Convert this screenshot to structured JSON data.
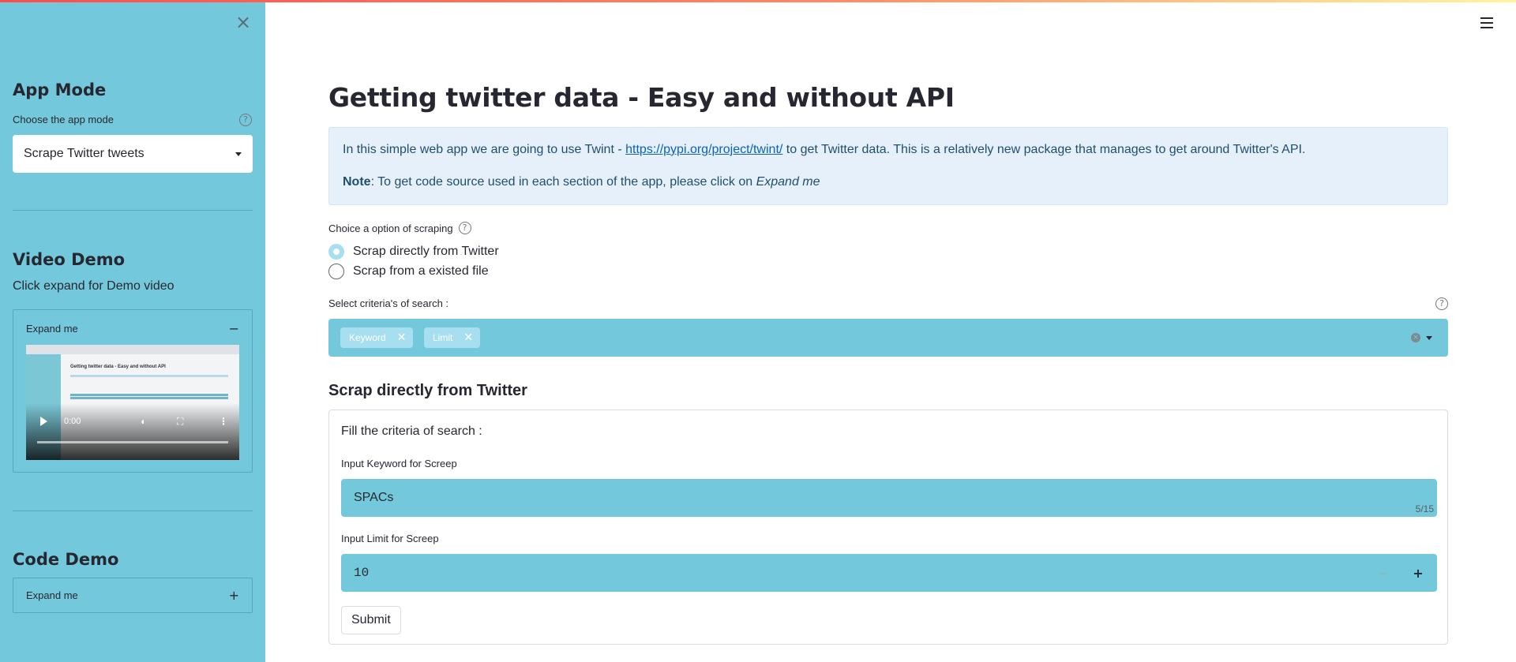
{
  "sidebar": {
    "close_icon": "close-icon",
    "app_mode": {
      "heading": "App Mode",
      "select_label": "Choose the app mode",
      "selected": "Scrape Twitter tweets"
    },
    "video_demo": {
      "heading": "Video Demo",
      "text": "Click expand for Demo video",
      "expander_label": "Expand me",
      "expander_state": "expanded",
      "player": {
        "time": "0:00",
        "thumbnail_title": "Getting twitter data - Easy and without API"
      }
    },
    "code_demo": {
      "heading": "Code Demo",
      "expander_label": "Expand me",
      "expander_state": "collapsed"
    }
  },
  "main": {
    "menu_icon": "hamburger-icon",
    "title": "Getting twitter data - Easy and without API",
    "info": {
      "line1_before": "In this simple web app we are going to use Twint - ",
      "line1_link": "https://pypi.org/project/twint/",
      "line1_after": " to get Twitter data. This is a relatively new package that manages to get around Twitter's API.",
      "line2_bold": "Note",
      "line2_text": ": To get code source used in each section of the app, please click on ",
      "line2_em": "Expand me"
    },
    "scraping": {
      "label": "Choice a option of scraping",
      "options": [
        "Scrap directly from Twitter",
        "Scrap from a existed file"
      ],
      "selected_index": 0
    },
    "criteria": {
      "label": "Select criteria's of search :",
      "chips": [
        "Keyword",
        "Limit"
      ]
    },
    "section_heading": "Scrap directly from Twitter",
    "form": {
      "title": "Fill the criteria of search :",
      "keyword_label": "Input Keyword for Screep",
      "keyword_value": "SPACs",
      "keyword_counter": "5/15",
      "limit_label": "Input Limit for Screep",
      "limit_value": "10",
      "submit_label": "Submit"
    }
  },
  "colors": {
    "sidebar_bg": "#74c8db",
    "input_bg": "#74c8db",
    "chip_bg": "#a7dff0",
    "info_bg": "#e6f0fb"
  }
}
